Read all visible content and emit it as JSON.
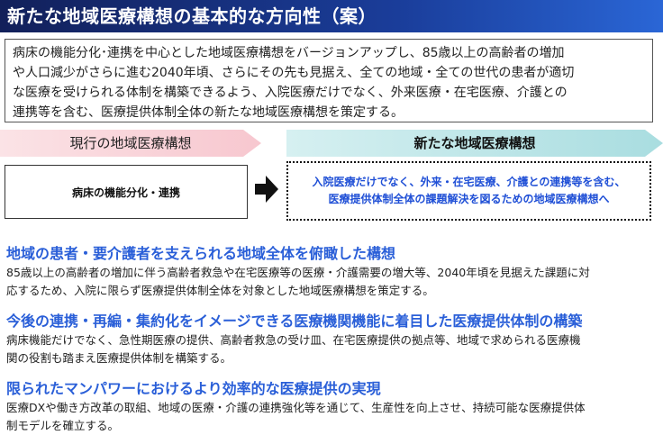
{
  "title": "新たな地域医療構想の基本的な方向性（案）",
  "intro_lines": [
    "病床の機能分化･連携を中心とした地域医療構想をバージョンアップし、85歳以上の高齢者の増加",
    "や人口減少がさらに進む2040年頃、さらにその先も見据え、全ての地域・全ての世代の患者が適切",
    "な医療を受けられる体制を構築できるよう、入院医療だけでなく、外来医療・在宅医療、介護との",
    "連携等を含む、医療提供体制全体の新たな地域医療構想を策定する。"
  ],
  "current": {
    "arrow_label": "現行の地域医療構想",
    "box_text": "病床の機能分化・連携"
  },
  "new": {
    "arrow_label": "新たな地域医療構想",
    "box_lines": [
      "入院医療だけでなく、外来・在宅医療、介護との連携等を含む、",
      "医療提供体制全体の課題解決を図るための地域医療構想へ"
    ]
  },
  "sections": [
    {
      "heading": "地域の患者・要介護者を支えられる地域全体を俯瞰した構想",
      "lines": [
        "85歳以上の高齢者の増加に伴う高齢者救急や在宅医療等の医療・介護需要の増大等、2040年頃を見据えた課題に対",
        "応するため、入院に限らず医療提供体制全体を対象とした地域医療構想を策定する。"
      ]
    },
    {
      "heading": "今後の連携・再編・集約化をイメージできる医療機関機能に着目した医療提供体制の構築",
      "lines": [
        "病床機能だけでなく、急性期医療の提供、高齢者救急の受け皿、在宅医療提供の拠点等、地域で求められる医療機",
        "関の役割も踏まえ医療提供体制を構築する。"
      ]
    },
    {
      "heading": "限られたマンパワーにおけるより効率的な医療提供の実現",
      "lines": [
        "医療DXや働き方改革の取組、地域の医療・介護の連携強化等を通じて、生産性を向上させ、持続可能な医療提供体",
        "制モデルを確立する。"
      ]
    }
  ]
}
